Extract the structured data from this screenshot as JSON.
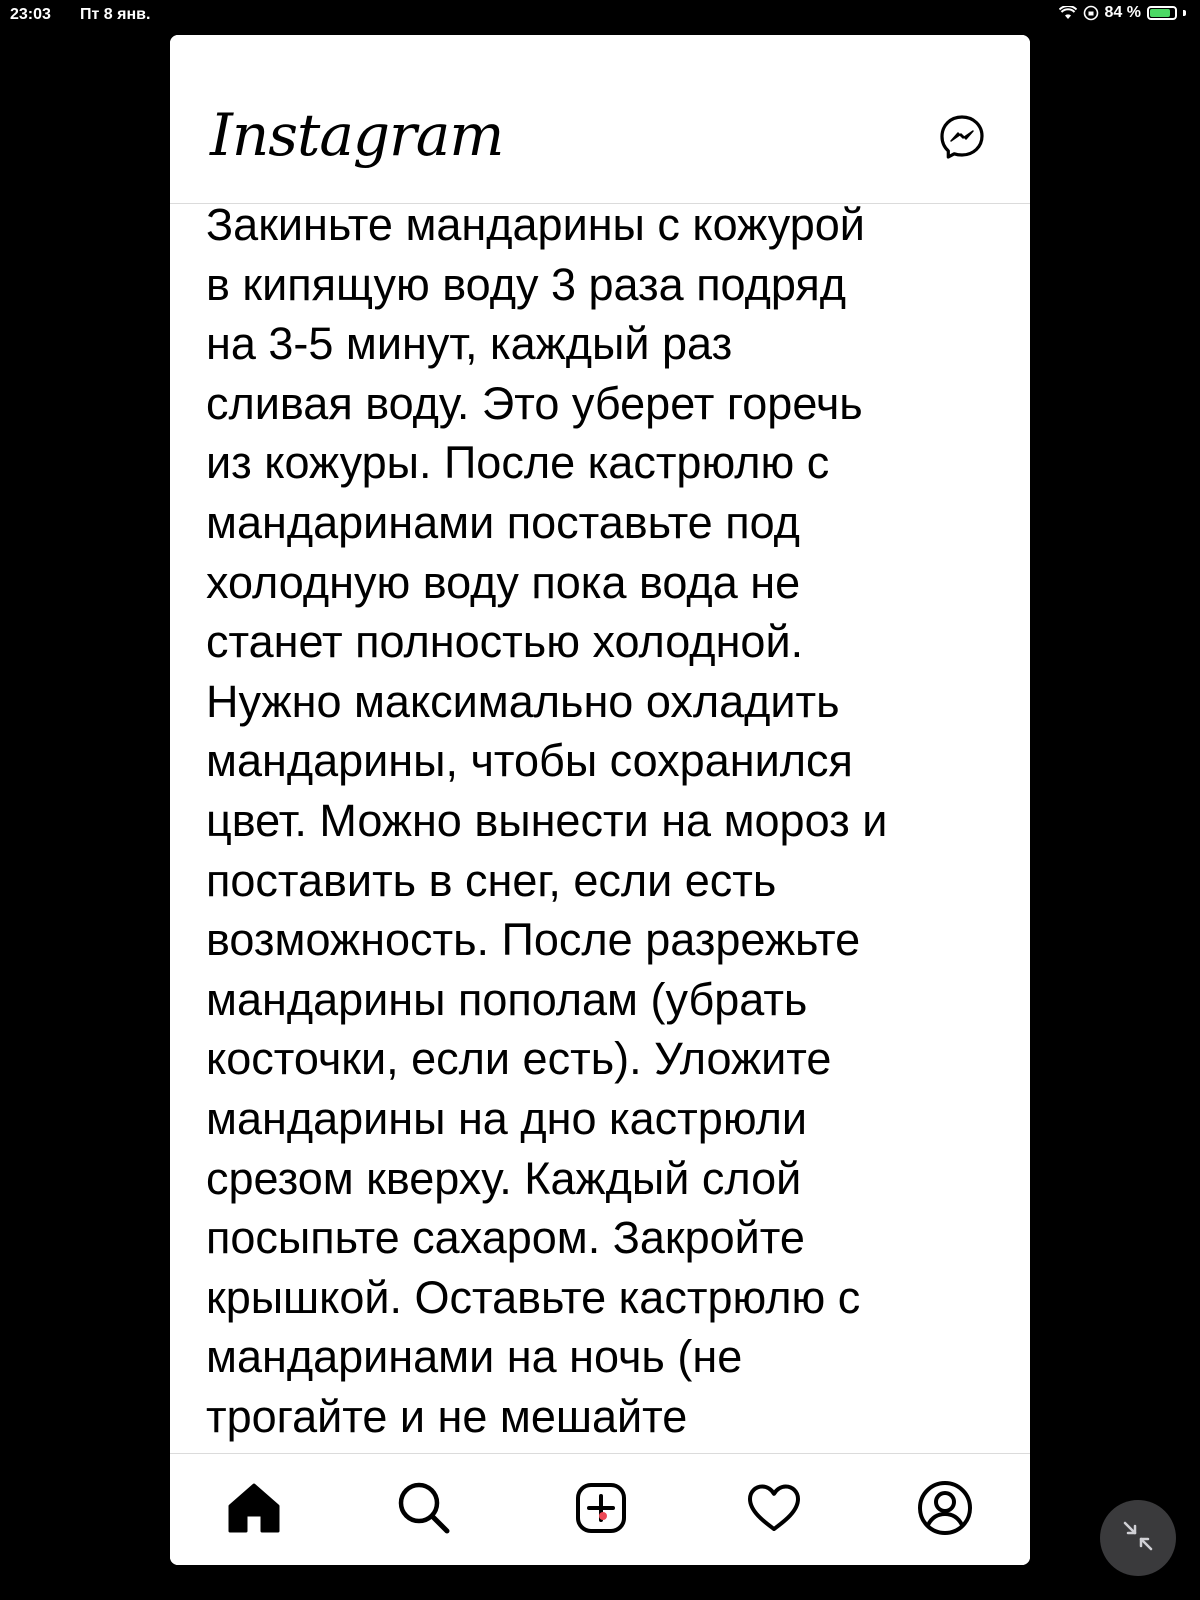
{
  "status_bar": {
    "time": "23:03",
    "date": "Пт 8 янв.",
    "battery": "84 %",
    "battery_level": 0.84,
    "icons": [
      "wifi-icon",
      "orientation-lock-icon",
      "battery-charging-icon"
    ]
  },
  "header": {
    "logo": "Instagram",
    "messenger_icon": "messenger-icon"
  },
  "post": {
    "lines": [
      "Закиньте мандарины с кожурой",
      "в кипящую воду 3 раза подряд",
      "на 3-5 минут, каждый раз",
      "сливая воду. Это уберет горечь",
      "из кожуры. После кастрюлю с",
      "мандаринами поставьте под",
      "холодную воду пока вода не",
      "станет полностью холодной.",
      "Нужно максимально охладить",
      "мандарины, чтобы сохранился",
      "цвет. Можно вынести на мороз и",
      "поставить в снег, если есть",
      "возможность. После разрежьте",
      "мандарины пополам (убрать",
      "косточки, если есть). Уложите",
      "мандарины на дно кастрюли",
      "срезом кверху. Каждый слой",
      "посыпьте сахаром. Закройте",
      "крышкой. Оставьте кастрюлю с",
      "мандаринами на ночь (не",
      "трогайте и не мешайте"
    ]
  },
  "bottom_nav": {
    "items": [
      "home-icon",
      "search-icon",
      "new-post-icon",
      "activity-heart-icon",
      "profile-icon"
    ],
    "notification_dot_color": "#ed4956"
  },
  "overlay": {
    "collapse_icon": "collapse-arrows-icon"
  }
}
